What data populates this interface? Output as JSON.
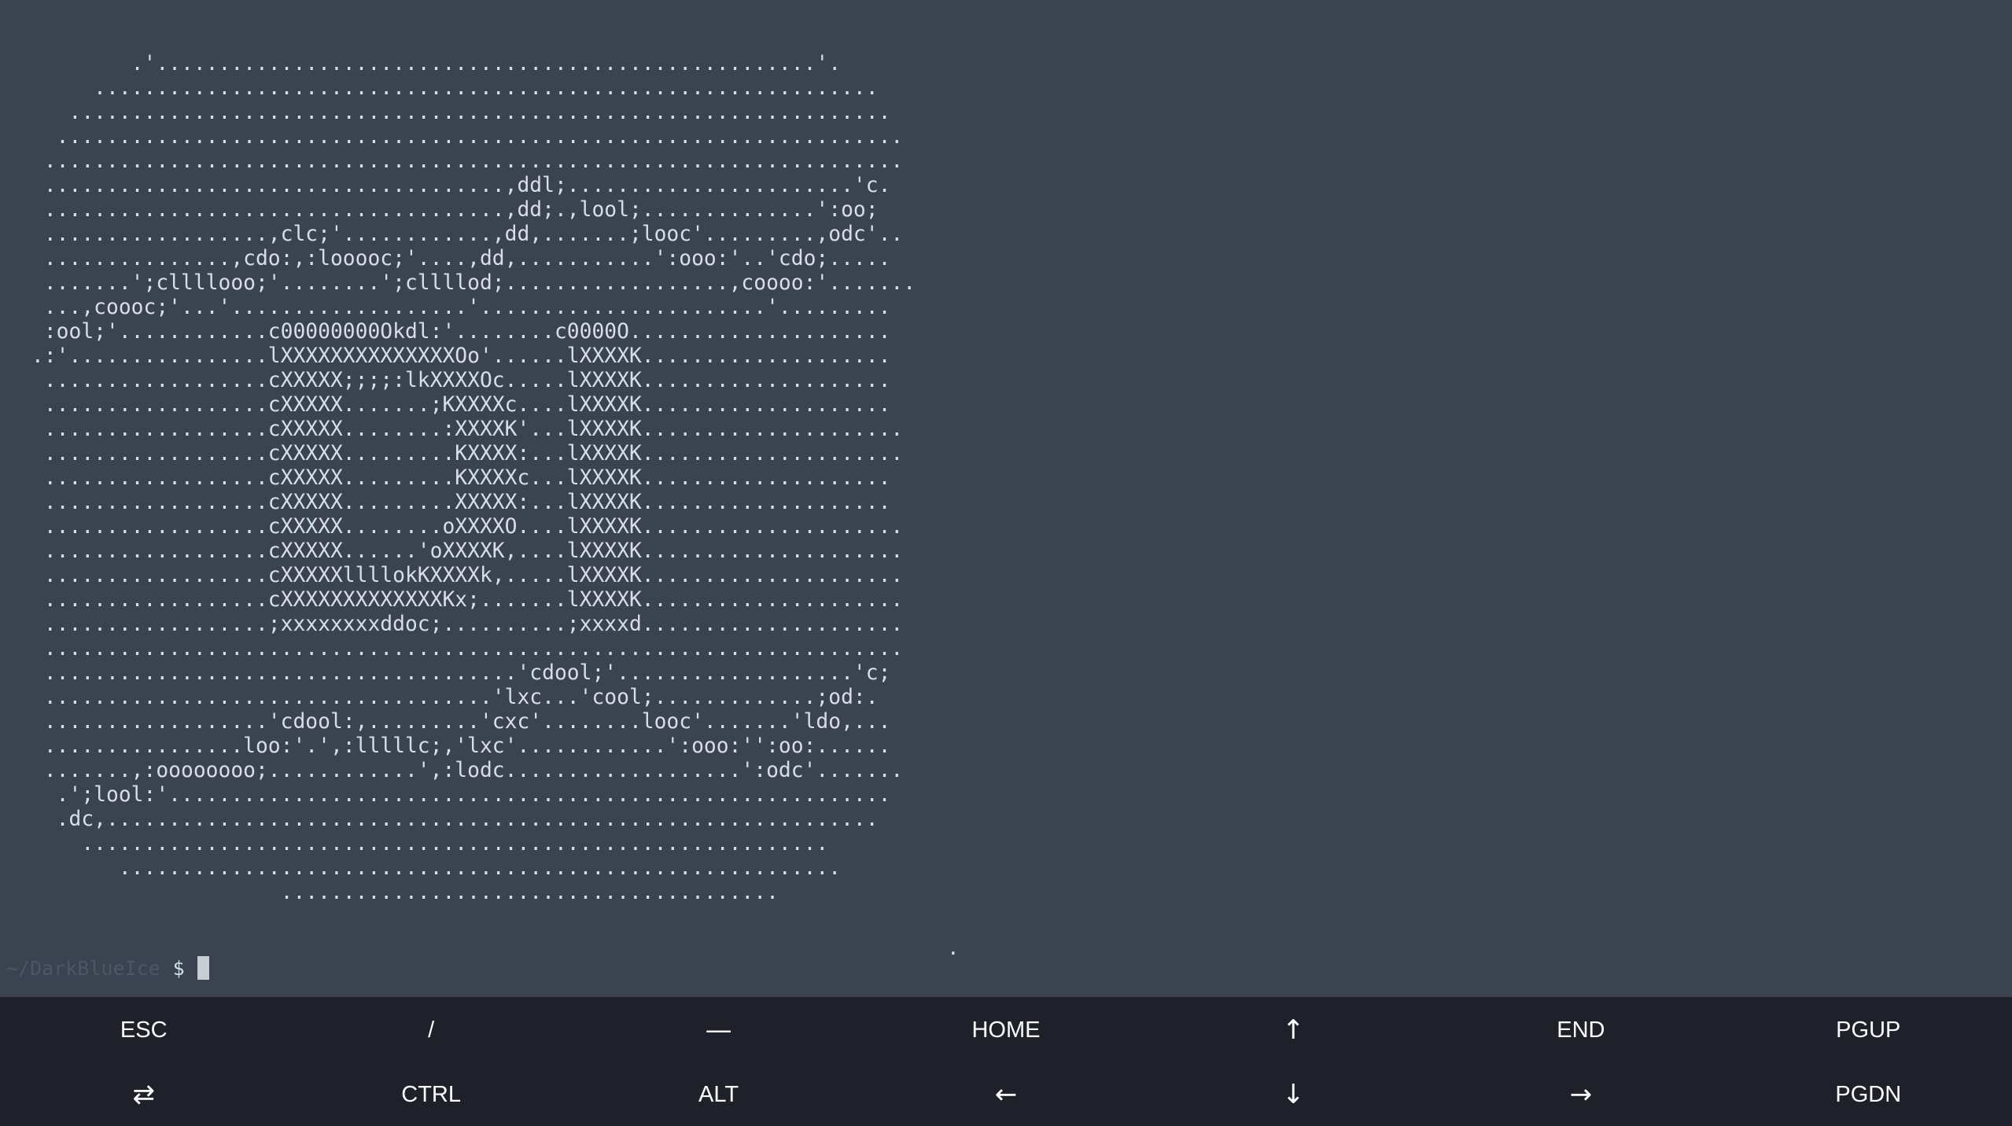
{
  "terminal": {
    "ascii_lines": [
      "        .'.....................................................'.",
      "     ...............................................................",
      "   ..................................................................",
      "  ....................................................................",
      " .....................................................................",
      " .....................................,ddl;.......................'c.",
      " .....................................,dd;.,lool;..............':oo;",
      " ..................,clc;'............,dd,.......;looc'.........,odc'..",
      " ...............,cdo:,:looooc;'....,dd,...........':ooo:'..'cdo;.....",
      " .......';cllllooo;'........';cllllod;..................,coooo:'.......",
      " ...,coooc;'...'...................'.......................'.........",
      " :ool;'............c00000000Okdl:'........c0000O.....................",
      ".:'................lXXXXXXXXXXXXXXOo'......lXXXXK....................",
      " ..................cXXXXX;;;;:lkXXXXOc.....lXXXXK....................",
      " ..................cXXXXX.......;KXXXXc....lXXXXK....................",
      " ..................cXXXXX........:XXXXK'...lXXXXK.....................",
      " ..................cXXXXX.........KXXXX:...lXXXXK.....................",
      " ..................cXXXXX.........KXXXXc...lXXXXK....................",
      " ..................cXXXXX.........XXXXX:...lXXXXK....................",
      " ..................cXXXXX........oXXXXO....lXXXXK.....................",
      " ..................cXXXXX......'oXXXXK,....lXXXXK.....................",
      " ..................cXXXXXllllokKXXXXk,.....lXXXXK.....................",
      " ..................cXXXXXXXXXXXXXKx;.......lXXXXK.....................",
      " ..................;xxxxxxxxddoc;..........;xxxxd.....................",
      " .....................................................................",
      " ......................................'cdool;'...................'c;",
      " ....................................'lxc...'cool;.............;od:.",
      " ..................'cdool:,.........'cxc'........looc'.......'ldo,...",
      " ................loo:'.',:lllllc;,'lxc'............':ooo:'':oo:......",
      " .......,:oooooooo;............',:lodc...................':odc'.......",
      "  .';lool:'..........................................................",
      "  .dc,..............................................................",
      "    ............................................................",
      "       ..........................................................",
      "                    ........................................"
    ],
    "tail_dots": [
      ".",
      "."
    ],
    "prompt_path": "~/DarkBlueIce",
    "prompt_symbol": "$"
  },
  "extra_keys": {
    "row1": [
      "ESC",
      "/",
      "—",
      "HOME",
      "↑",
      "END",
      "PGUP"
    ],
    "row2": [
      "⇄",
      "CTRL",
      "ALT",
      "←",
      "↓",
      "→",
      "PGDN"
    ]
  },
  "colors": {
    "terminal_bg": "#3b4250",
    "terminal_fg": "#d8dee9",
    "prompt_path": "#4c566a",
    "keys_bg": "#1e2129",
    "keys_fg": "#ffffff"
  }
}
